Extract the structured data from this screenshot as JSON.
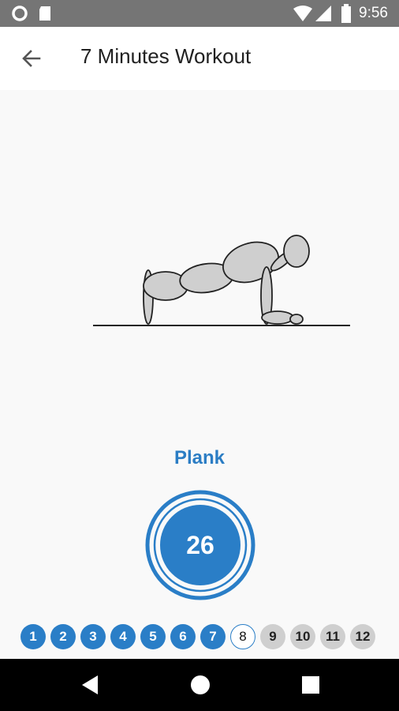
{
  "status_bar": {
    "time": "9:56",
    "icons": [
      "circle-notification-icon",
      "sd-card-icon",
      "wifi-icon",
      "signal-icon",
      "battery-icon"
    ]
  },
  "app_bar": {
    "title": "7 Minutes Workout",
    "back_icon": "arrow-back-icon"
  },
  "exercise": {
    "name": "Plank",
    "illustration": "plank-figure"
  },
  "timer": {
    "seconds_remaining": "26",
    "ring_color": "#2a7ec7"
  },
  "progress": {
    "steps": [
      {
        "label": "1",
        "state": "done"
      },
      {
        "label": "2",
        "state": "done"
      },
      {
        "label": "3",
        "state": "done"
      },
      {
        "label": "4",
        "state": "done"
      },
      {
        "label": "5",
        "state": "done"
      },
      {
        "label": "6",
        "state": "done"
      },
      {
        "label": "7",
        "state": "done"
      },
      {
        "label": "8",
        "state": "current"
      },
      {
        "label": "9",
        "state": "todo"
      },
      {
        "label": "10",
        "state": "todo"
      },
      {
        "label": "11",
        "state": "todo"
      },
      {
        "label": "12",
        "state": "todo"
      }
    ]
  },
  "nav_bar": {
    "icons": [
      "back-triangle-icon",
      "home-circle-icon",
      "recents-square-icon"
    ]
  },
  "colors": {
    "accent": "#2a7ec7",
    "status_bar": "#757575",
    "pending_step": "#cfcfcf"
  }
}
